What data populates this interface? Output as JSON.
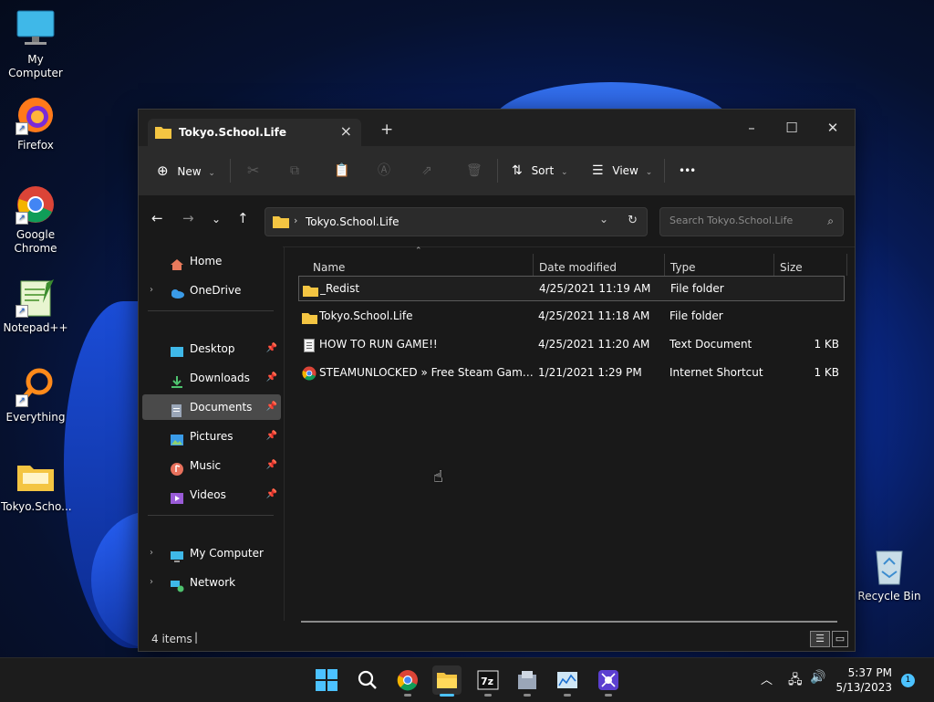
{
  "desktop": {
    "icons": [
      {
        "label": "My Computer"
      },
      {
        "label": "Firefox"
      },
      {
        "label": "Google Chrome"
      },
      {
        "label": "Notepad++"
      },
      {
        "label": "Everything"
      },
      {
        "label": "Tokyo.Scho..."
      },
      {
        "label": "Recycle Bin"
      }
    ]
  },
  "explorer": {
    "tab_title": "Tokyo.School.Life",
    "toolbar": {
      "new_label": "New",
      "sort_label": "Sort",
      "view_label": "View",
      "more_label": "•••"
    },
    "address": {
      "path": "Tokyo.School.Life",
      "search_placeholder": "Search Tokyo.School.Life"
    },
    "nav": {
      "home": "Home",
      "onedrive": "OneDrive",
      "desktop": "Desktop",
      "downloads": "Downloads",
      "documents": "Documents",
      "pictures": "Pictures",
      "music": "Music",
      "videos": "Videos",
      "my_computer": "My Computer",
      "network": "Network"
    },
    "columns": {
      "name": "Name",
      "date_modified": "Date modified",
      "type": "Type",
      "size": "Size"
    },
    "files": [
      {
        "name": "_Redist",
        "date": "4/25/2021 11:19 AM",
        "type": "File folder",
        "size": ""
      },
      {
        "name": "Tokyo.School.Life",
        "date": "4/25/2021 11:18 AM",
        "type": "File folder",
        "size": ""
      },
      {
        "name": "HOW TO RUN GAME!!",
        "date": "4/25/2021 11:20 AM",
        "type": "Text Document",
        "size": "1 KB"
      },
      {
        "name": "STEAMUNLOCKED » Free Steam Games P...",
        "date": "1/21/2021 1:29 PM",
        "type": "Internet Shortcut",
        "size": "1 KB"
      }
    ],
    "status": {
      "item_count": "4 items"
    }
  },
  "taskbar": {
    "time": "5:37 PM",
    "date": "5/13/2023",
    "notification_count": "1"
  },
  "colors": {
    "accent": "#4cc2ff",
    "folder": "#f4c542",
    "window_bg": "#191919",
    "toolbar_bg": "#2b2b2b"
  }
}
